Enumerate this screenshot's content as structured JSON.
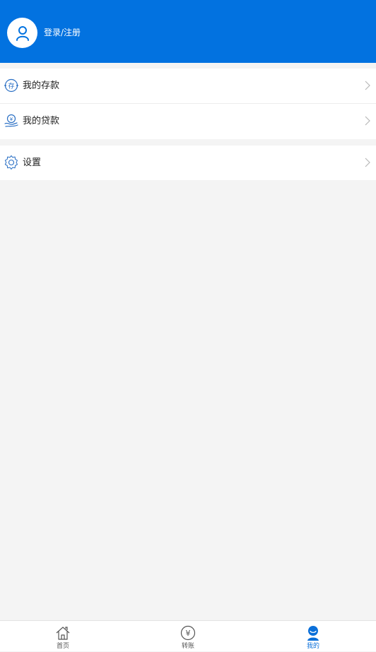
{
  "header": {
    "login_label": "登录/注册"
  },
  "menu": {
    "deposits_label": "我的存款",
    "loans_label": "我的贷款",
    "settings_label": "设置"
  },
  "tabbar": {
    "home_label": "首页",
    "transfer_label": "转账",
    "mine_label": "我的",
    "active_tab": "我的"
  },
  "colors": {
    "primary": "#0272e0",
    "icon_blue": "#2a6fc4",
    "background": "#f4f4f4"
  }
}
